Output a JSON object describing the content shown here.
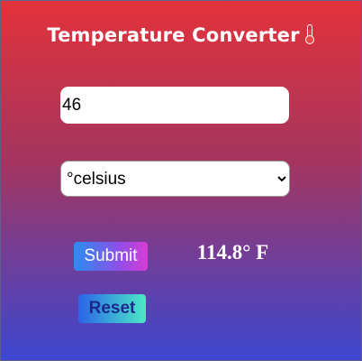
{
  "app": {
    "title": "Temperature Converter"
  },
  "form": {
    "temperature_value": "46",
    "unit_selected": "°celsius",
    "submit_label": "Submit",
    "reset_label": "Reset"
  },
  "result": {
    "text": "114.8° F"
  },
  "icons": {
    "title_icon": "thermometer-icon"
  },
  "colors": {
    "gradient_top": "#e3323a",
    "gradient_bottom": "#3c47d0",
    "submit_start": "#2a8ef0",
    "submit_end": "#d93bd6",
    "reset_start": "#2b63e6",
    "reset_end": "#4de8c6",
    "reset_text": "#1a2a8a"
  }
}
